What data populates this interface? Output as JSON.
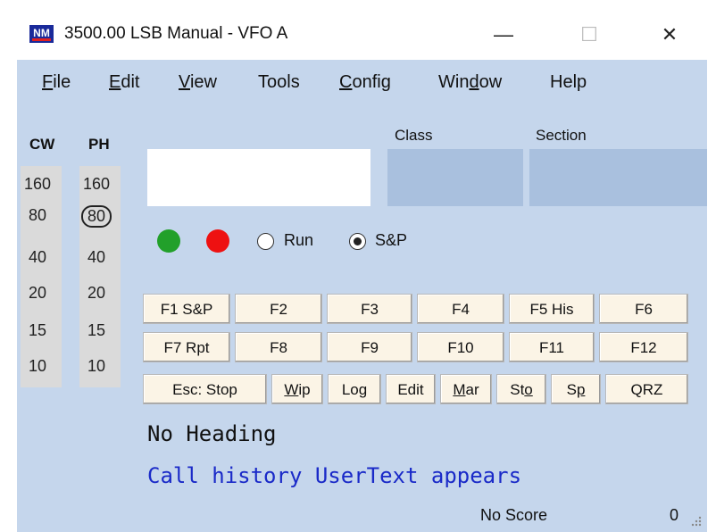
{
  "window": {
    "title": "3500.00 LSB Manual - VFO A",
    "minimize_glyph": "—",
    "maximize_glyph": "☐",
    "close_glyph": "✕"
  },
  "menu": [
    "File",
    "Edit",
    "View",
    "Tools",
    "Config",
    "Window",
    "Help"
  ],
  "bands": {
    "cw_header": "CW",
    "ph_header": "PH",
    "cw": [
      "160",
      "80",
      "40",
      "20",
      "15",
      "10"
    ],
    "ph": [
      "160",
      "80",
      "40",
      "20",
      "15",
      "10"
    ],
    "selected_ph": "80"
  },
  "entry": {
    "call_value": "",
    "class_label": "Class",
    "section_label": "Section",
    "class_value": "",
    "section_value": ""
  },
  "indicators": {
    "green_color": "#22a02a",
    "red_color": "#ee1111"
  },
  "mode": {
    "run_label": "Run",
    "sp_label": "S&P",
    "selected": "S&P"
  },
  "fkeys_row1": [
    "F1 S&P",
    "F2",
    "F3",
    "F4",
    "F5 His",
    "F6"
  ],
  "fkeys_row2": [
    "F7 Rpt",
    "F8",
    "F9",
    "F10",
    "F11",
    "F12"
  ],
  "action_buttons": [
    "Esc: Stop",
    "Wip",
    "Log",
    "Edit",
    "Mar",
    "Sto",
    "Sp",
    "QRZ"
  ],
  "info": {
    "heading_text": "No Heading",
    "call_history_text": "Call history UserText appears",
    "call_history_color": "#1a2ac8"
  },
  "status": {
    "score_label": "No Score",
    "score_value": "0"
  }
}
